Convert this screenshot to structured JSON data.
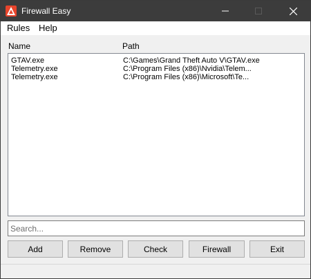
{
  "window": {
    "title": "Firewall Easy",
    "icon": "firewall-app-icon",
    "titlebar_color": "#3c3c3c"
  },
  "menu": {
    "items": [
      {
        "label": "Rules"
      },
      {
        "label": "Help"
      }
    ]
  },
  "list": {
    "columns": [
      "Name",
      "Path"
    ],
    "rows": [
      {
        "name": "GTAV.exe",
        "path": "C:\\Games\\Grand Theft Auto V\\GTAV.exe"
      },
      {
        "name": "Telemetry.exe",
        "path": "C:\\Program Files (x86)\\Nvidia\\Telem..."
      },
      {
        "name": "Telemetry.exe",
        "path": "C:\\Program Files (x86)\\Microsoft\\Te..."
      }
    ]
  },
  "search": {
    "placeholder": "Search...",
    "value": ""
  },
  "buttons": {
    "add": "Add",
    "remove": "Remove",
    "check": "Check",
    "firewall": "Firewall",
    "exit": "Exit"
  }
}
